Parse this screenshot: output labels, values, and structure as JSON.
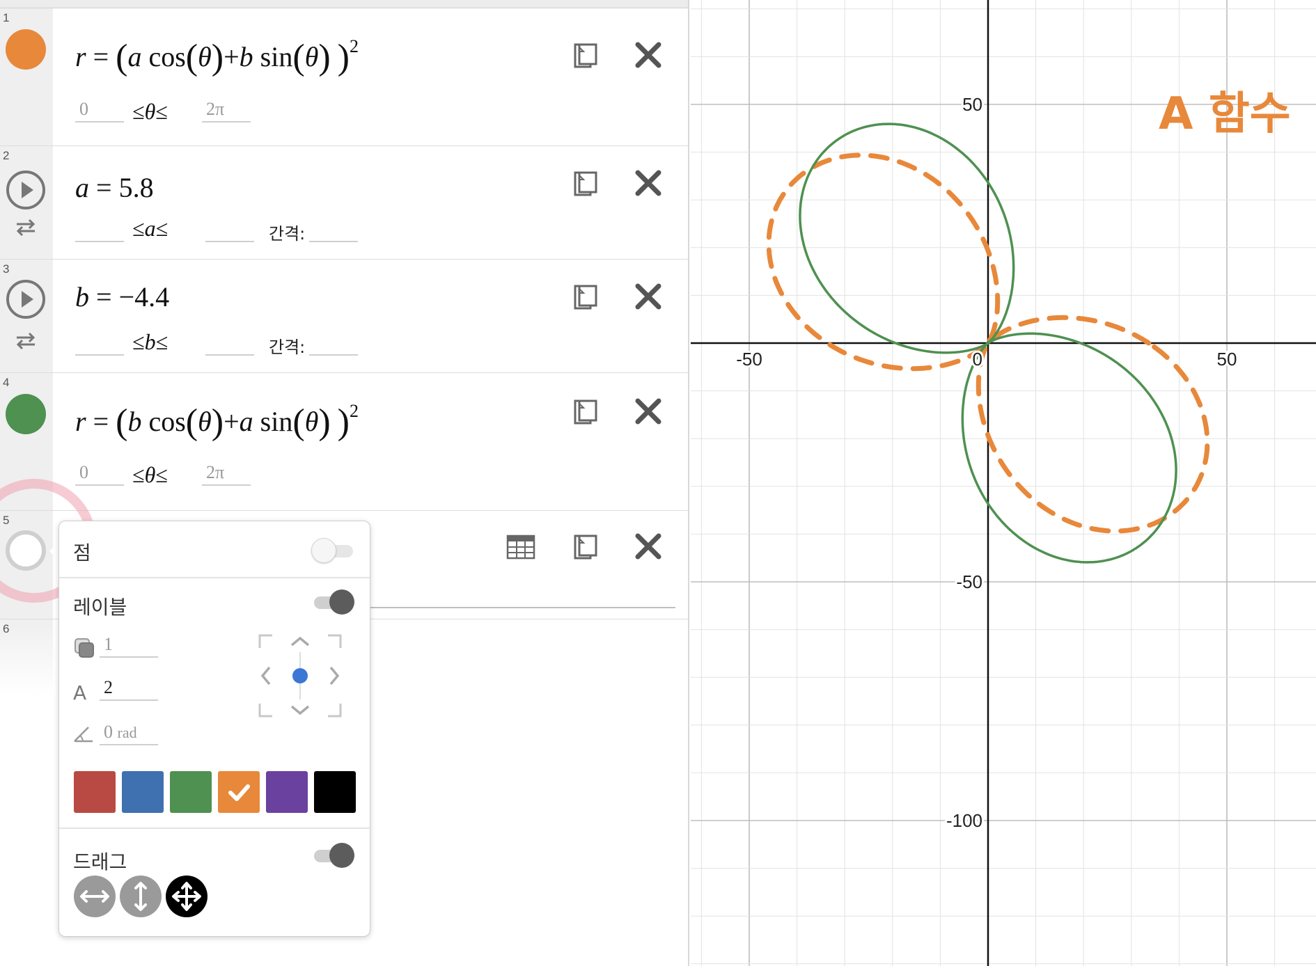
{
  "expressions": [
    {
      "num": "1",
      "type": "polar",
      "color": "#e8883a",
      "lhs": "r",
      "term1_coef": "a",
      "term2_coef": "b",
      "term2_sign": "+",
      "exponent": "2",
      "theta_min": "0",
      "theta_max": "2π"
    },
    {
      "num": "2",
      "type": "slider",
      "var": "a",
      "value": "5.8",
      "step_label": "간격:"
    },
    {
      "num": "3",
      "type": "slider",
      "var": "b",
      "value": "−4.4",
      "step_label": "간격:"
    },
    {
      "num": "4",
      "type": "polar",
      "color": "#4e9150",
      "lhs": "r",
      "term1_coef": "b",
      "term2_coef": "a",
      "term2_sign": "+",
      "exponent": "2",
      "theta_min": "0",
      "theta_max": "2π"
    },
    {
      "num": "5",
      "type": "empty"
    },
    {
      "num": "6",
      "type": "empty"
    }
  ],
  "math_words": {
    "cos": "cos",
    "sin": "sin",
    "theta": "θ",
    "leq": "≤",
    "eq": "="
  },
  "style_menu": {
    "point_label": "점",
    "point_enabled": false,
    "label_label": "레이블",
    "label_enabled": true,
    "opacity_value": "1",
    "text_size_letter": "A",
    "text_size_value": "2",
    "angle_value": "0",
    "angle_unit": "rad",
    "colors": [
      "#b94a43",
      "#3f70b0",
      "#4e9150",
      "#e8883a",
      "#6b41a0",
      "#000000"
    ],
    "selected_color": "#e8883a",
    "drag_label": "드래그",
    "drag_enabled": true,
    "drag_modes": [
      "horizontal",
      "vertical",
      "both"
    ],
    "selected_drag_mode": "both"
  },
  "graph": {
    "x_range": [
      -60,
      68
    ],
    "y_range": [
      -130,
      72
    ],
    "minor_step": 10,
    "major_step": 50,
    "x_tick_labels": [
      "-50",
      "0",
      "50"
    ],
    "y_tick_labels": [
      "50",
      "-50",
      "-100"
    ],
    "annotation": "A 함수",
    "annotation_color": "#e8883a",
    "curves": [
      {
        "expr": "r = (a cos θ + b sin θ)^2",
        "a": 5.8,
        "b": -4.4,
        "color": "#e8883a",
        "style": "dashed"
      },
      {
        "expr": "r = (b cos θ + a sin θ)^2",
        "a": 5.8,
        "b": -4.4,
        "color": "#4e9150",
        "style": "solid"
      }
    ]
  }
}
